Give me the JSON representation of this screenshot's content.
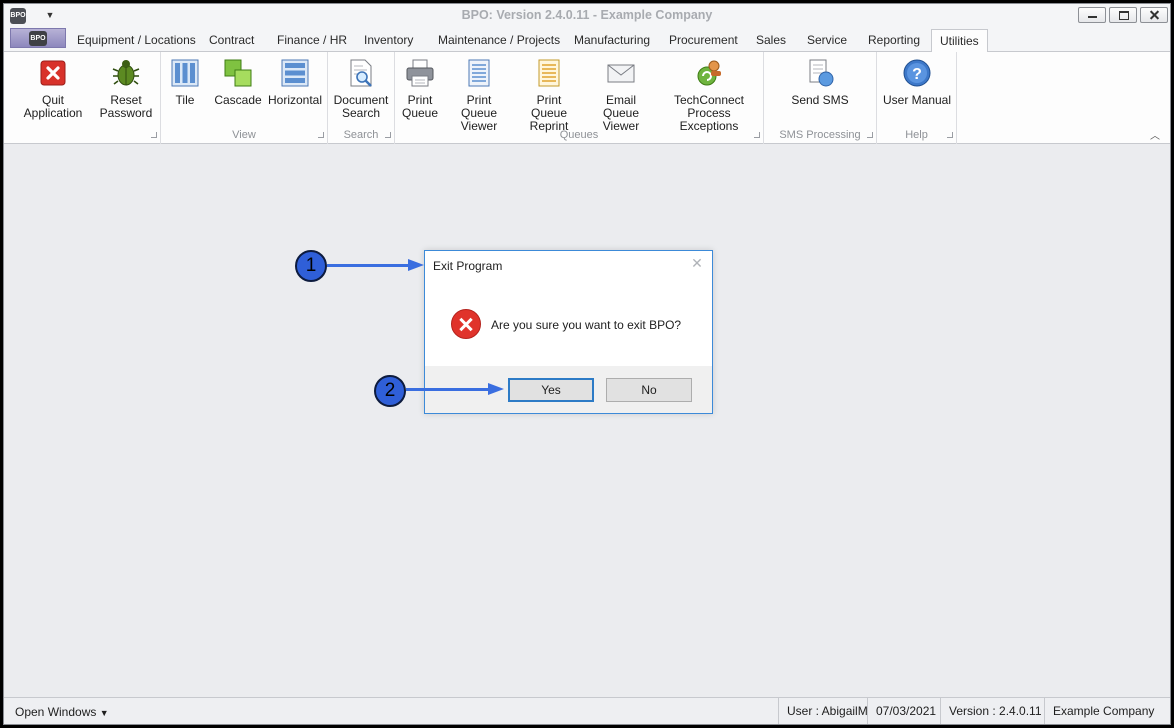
{
  "window": {
    "title": "BPO: Version 2.4.0.11 - Example Company",
    "app_icon_text": "BPO"
  },
  "tabs": [
    {
      "label": "Equipment / Locations"
    },
    {
      "label": "Contract"
    },
    {
      "label": "Finance / HR"
    },
    {
      "label": "Inventory"
    },
    {
      "label": "Maintenance / Projects"
    },
    {
      "label": "Manufacturing"
    },
    {
      "label": "Procurement"
    },
    {
      "label": "Sales"
    },
    {
      "label": "Service"
    },
    {
      "label": "Reporting"
    },
    {
      "label": "Utilities",
      "active": true
    }
  ],
  "ribbon": {
    "groups": [
      {
        "caption": "",
        "buttons": [
          {
            "line1": "Quit Application",
            "line2": "",
            "icon": "quit-icon"
          },
          {
            "line1": "Reset",
            "line2": "Password",
            "icon": "bug-icon"
          }
        ]
      },
      {
        "caption": "View",
        "buttons": [
          {
            "line1": "Tile",
            "line2": "",
            "icon": "tile-icon"
          },
          {
            "line1": "Cascade",
            "line2": "",
            "icon": "cascade-icon"
          },
          {
            "line1": "Horizontal",
            "line2": "",
            "icon": "horizontal-icon"
          }
        ]
      },
      {
        "caption": "Search",
        "buttons": [
          {
            "line1": "Document",
            "line2": "Search",
            "icon": "document-search-icon"
          }
        ]
      },
      {
        "caption": "Queues",
        "buttons": [
          {
            "line1": "Print",
            "line2": "Queue",
            "icon": "printer-icon"
          },
          {
            "line1": "Print Queue",
            "line2": "Viewer",
            "icon": "print-queue-viewer-icon"
          },
          {
            "line1": "Print Queue",
            "line2": "Reprint",
            "icon": "print-queue-reprint-icon"
          },
          {
            "line1": "Email Queue",
            "line2": "Viewer",
            "icon": "envelope-icon"
          },
          {
            "line1": "TechConnect",
            "line2": "Process Exceptions",
            "icon": "techconnect-icon"
          }
        ]
      },
      {
        "caption": "SMS Processing",
        "buttons": [
          {
            "line1": "Send SMS",
            "line2": "",
            "icon": "send-sms-icon"
          }
        ]
      },
      {
        "caption": "Help",
        "buttons": [
          {
            "line1": "User Manual",
            "line2": "",
            "icon": "help-icon"
          }
        ]
      }
    ]
  },
  "dialog": {
    "title": "Exit Program",
    "message": "Are you sure you want to exit BPO?",
    "yes_label": "Yes",
    "no_label": "No",
    "close_glyph": "✕"
  },
  "callouts": [
    {
      "number": "1"
    },
    {
      "number": "2"
    }
  ],
  "statusbar": {
    "open_windows_label": "Open Windows",
    "user": "User : AbigailM",
    "date": "07/03/2021",
    "version": "Version : 2.4.0.11",
    "company": "Example Company"
  },
  "colors": {
    "accent_blue": "#2f5fd8",
    "dialog_border": "#3c8ad8",
    "error_red": "#e0332b"
  }
}
